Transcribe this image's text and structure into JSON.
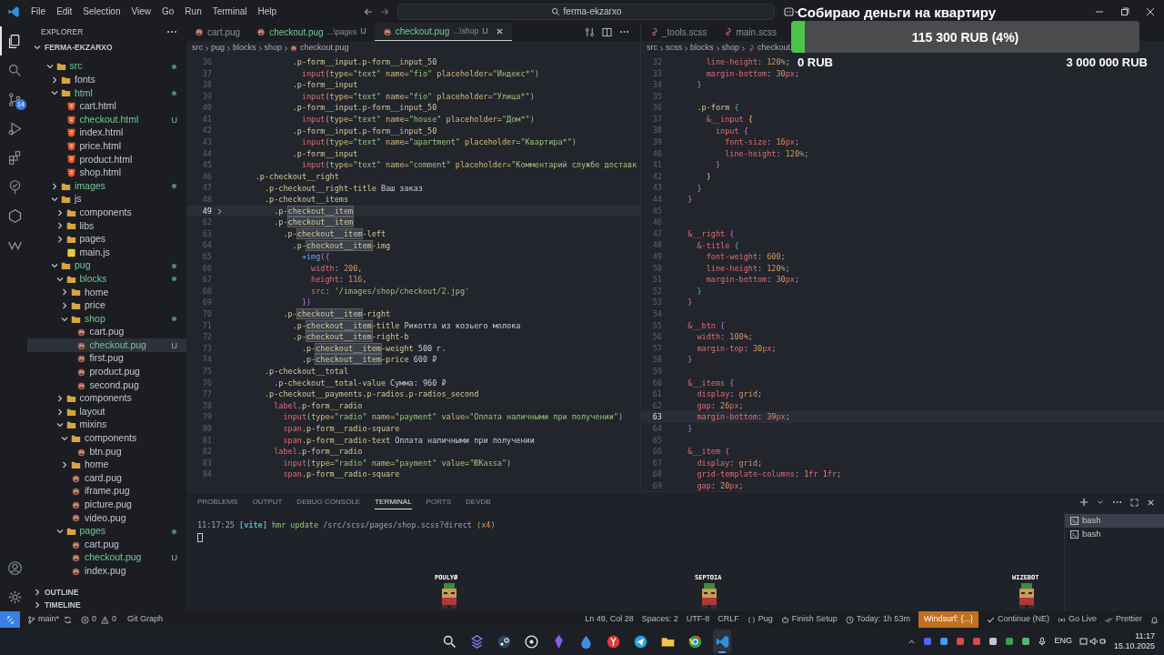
{
  "title_bar": {
    "menus": [
      "File",
      "Edit",
      "Selection",
      "View",
      "Go",
      "Run",
      "Terminal",
      "Help"
    ],
    "search": {
      "value": "ferma-ekzarxo"
    }
  },
  "activity_bar": {
    "items": [
      {
        "kind": "explorer",
        "selected": true
      },
      {
        "kind": "search",
        "selected": false
      },
      {
        "kind": "scm",
        "selected": false,
        "badge": "14"
      },
      {
        "kind": "debug",
        "selected": false
      },
      {
        "kind": "extensions",
        "selected": false
      },
      {
        "kind": "tree",
        "selected": false
      },
      {
        "kind": "hexagon",
        "selected": false
      },
      {
        "kind": "wave",
        "selected": false
      }
    ],
    "bottom": [
      {
        "kind": "account"
      },
      {
        "kind": "settings"
      }
    ]
  },
  "sidebar": {
    "title": "EXPLORER",
    "section": "FERMA-EKZARXO",
    "tree": [
      {
        "name": "src",
        "kind": "folder",
        "expanded": true,
        "changed": true,
        "selected": false,
        "children": [
          {
            "name": "fonts",
            "kind": "folder",
            "expanded": false,
            "changed": false,
            "selected": false
          },
          {
            "name": "html",
            "kind": "folder",
            "expanded": true,
            "changed": true,
            "selected": false,
            "children": [
              {
                "name": "cart.html",
                "kind": "html",
                "changed": false,
                "selected": false
              },
              {
                "name": "checkout.html",
                "kind": "html",
                "changed": true,
                "selected": false,
                "badge": "U"
              },
              {
                "name": "index.html",
                "kind": "html",
                "changed": false,
                "selected": false
              },
              {
                "name": "price.html",
                "kind": "html",
                "changed": false,
                "selected": false
              },
              {
                "name": "product.html",
                "kind": "html",
                "changed": false,
                "selected": false
              },
              {
                "name": "shop.html",
                "kind": "html",
                "changed": false,
                "selected": false
              }
            ]
          },
          {
            "name": "images",
            "kind": "folder",
            "expanded": false,
            "changed": true,
            "selected": false
          },
          {
            "name": "js",
            "kind": "folder",
            "expanded": true,
            "changed": false,
            "selected": false,
            "children": [
              {
                "name": "components",
                "kind": "folder",
                "expanded": false,
                "changed": false,
                "selected": false
              },
              {
                "name": "libs",
                "kind": "folder",
                "expanded": false,
                "changed": false,
                "selected": false
              },
              {
                "name": "pages",
                "kind": "folder",
                "expanded": false,
                "changed": false,
                "selected": false
              },
              {
                "name": "main.js",
                "kind": "js",
                "changed": false,
                "selected": false
              }
            ]
          },
          {
            "name": "pug",
            "kind": "folder",
            "expanded": true,
            "changed": true,
            "selected": false,
            "children": [
              {
                "name": "blocks",
                "kind": "folder",
                "expanded": true,
                "changed": true,
                "selected": false,
                "children": [
                  {
                    "name": "home",
                    "kind": "folder",
                    "expanded": false,
                    "changed": false,
                    "selected": false
                  },
                  {
                    "name": "price",
                    "kind": "folder",
                    "expanded": false,
                    "changed": false,
                    "selected": false
                  },
                  {
                    "name": "shop",
                    "kind": "folder",
                    "expanded": true,
                    "changed": true,
                    "selected": false,
                    "children": [
                      {
                        "name": "cart.pug",
                        "kind": "pug",
                        "changed": false,
                        "selected": false
                      },
                      {
                        "name": "checkout.pug",
                        "kind": "pug",
                        "changed": true,
                        "selected": true,
                        "badge": "U"
                      },
                      {
                        "name": "first.pug",
                        "kind": "pug",
                        "changed": false,
                        "selected": false
                      },
                      {
                        "name": "product.pug",
                        "kind": "pug",
                        "changed": false,
                        "selected": false
                      },
                      {
                        "name": "second.pug",
                        "kind": "pug",
                        "changed": false,
                        "selected": false
                      }
                    ]
                  }
                ]
              },
              {
                "name": "components",
                "kind": "folder",
                "expanded": false,
                "changed": false,
                "selected": false
              },
              {
                "name": "layout",
                "kind": "folder",
                "expanded": false,
                "changed": false,
                "selected": false
              },
              {
                "name": "mixins",
                "kind": "folder",
                "expanded": true,
                "changed": false,
                "selected": false,
                "children": [
                  {
                    "name": "components",
                    "kind": "folder",
                    "expanded": true,
                    "changed": false,
                    "selected": false,
                    "children": [
                      {
                        "name": "btn.pug",
                        "kind": "pug",
                        "changed": false,
                        "selected": false
                      }
                    ]
                  },
                  {
                    "name": "home",
                    "kind": "folder",
                    "expanded": false,
                    "changed": false,
                    "selected": false
                  },
                  {
                    "name": "card.pug",
                    "kind": "pug",
                    "changed": false,
                    "selected": false
                  },
                  {
                    "name": "iframe.pug",
                    "kind": "pug",
                    "changed": false,
                    "selected": false
                  },
                  {
                    "name": "picture.pug",
                    "kind": "pug",
                    "changed": false,
                    "selected": false
                  },
                  {
                    "name": "video.pug",
                    "kind": "pug",
                    "changed": false,
                    "selected": false
                  }
                ]
              },
              {
                "name": "pages",
                "kind": "folder",
                "expanded": true,
                "changed": true,
                "selected": false,
                "children": [
                  {
                    "name": "cart.pug",
                    "kind": "pug",
                    "changed": false,
                    "selected": false
                  },
                  {
                    "name": "checkout.pug",
                    "kind": "pug",
                    "changed": true,
                    "selected": false,
                    "badge": "U"
                  },
                  {
                    "name": "index.pug",
                    "kind": "pug",
                    "changed": false,
                    "selected": false
                  }
                ]
              }
            ]
          }
        ]
      }
    ],
    "bottom_sections": [
      "OUTLINE",
      "TIMELINE"
    ]
  },
  "left_editor": {
    "tabs": [
      {
        "label": "cart.pug",
        "selected": false
      },
      {
        "label": "checkout.pug",
        "detail": "...\\pages",
        "badge": "U",
        "selected": false
      },
      {
        "label": "checkout.pug",
        "detail": "...\\shop",
        "badge": "U",
        "selected": true
      }
    ],
    "breadcrumb": [
      "src",
      "pug",
      "blocks",
      "shop",
      "checkout.pug"
    ],
    "lines": [
      {
        "num": "36",
        "current": false,
        "folded": false,
        "tokens": [
          {
            "text": "              .p-form__input.p-form__input_50",
            "kind": "cls"
          }
        ]
      },
      {
        "num": "37",
        "current": false,
        "folded": false,
        "tokens": [
          {
            "text": "                input",
            "kind": "tag"
          },
          {
            "text": "(",
            "kind": "p"
          },
          {
            "text": "type=",
            "kind": "attr"
          },
          {
            "text": "\"text\"",
            "kind": "str"
          },
          {
            "text": " name=",
            "kind": "attr"
          },
          {
            "text": "\"fio\"",
            "kind": "str"
          },
          {
            "text": " placeholder=",
            "kind": "attr"
          },
          {
            "text": "\"Индекс*\"",
            "kind": "str"
          },
          {
            "text": ")",
            "kind": "p"
          }
        ]
      },
      {
        "num": "38",
        "current": false,
        "folded": false,
        "tokens": [
          {
            "text": "              .p-form__input",
            "kind": "cls"
          }
        ]
      },
      {
        "num": "39",
        "current": false,
        "folded": false,
        "tokens": [
          {
            "text": "                input",
            "kind": "tag"
          },
          {
            "text": "(",
            "kind": "p"
          },
          {
            "text": "type=",
            "kind": "attr"
          },
          {
            "text": "\"text\"",
            "kind": "str"
          },
          {
            "text": " name=",
            "kind": "attr"
          },
          {
            "text": "\"fio\"",
            "kind": "str"
          },
          {
            "text": " placeholder=",
            "kind": "attr"
          },
          {
            "text": "\"Улица*\"",
            "kind": "str"
          },
          {
            "text": ")",
            "kind": "p"
          }
        ]
      },
      {
        "num": "40",
        "current": false,
        "folded": false,
        "tokens": [
          {
            "text": "              .p-form__input.p-form__input_50",
            "kind": "cls"
          }
        ]
      },
      {
        "num": "41",
        "current": false,
        "folded": false,
        "tokens": [
          {
            "text": "                input",
            "kind": "tag"
          },
          {
            "text": "(",
            "kind": "p"
          },
          {
            "text": "type=",
            "kind": "attr"
          },
          {
            "text": "\"text\"",
            "kind": "str"
          },
          {
            "text": " name=",
            "kind": "attr"
          },
          {
            "text": "\"house\"",
            "kind": "str"
          },
          {
            "text": " placeholder=",
            "kind": "attr"
          },
          {
            "text": "\"Дом*\"",
            "kind": "str"
          },
          {
            "text": ")",
            "kind": "p"
          }
        ]
      },
      {
        "num": "42",
        "current": false,
        "folded": false,
        "tokens": [
          {
            "text": "              .p-form__input.p-form__input_50",
            "kind": "cls"
          }
        ]
      },
      {
        "num": "43",
        "current": false,
        "folded": false,
        "tokens": [
          {
            "text": "                input",
            "kind": "tag"
          },
          {
            "text": "(",
            "kind": "p"
          },
          {
            "text": "type=",
            "kind": "attr"
          },
          {
            "text": "\"text\"",
            "kind": "str"
          },
          {
            "text": " name=",
            "kind": "attr"
          },
          {
            "text": "\"apartment\"",
            "kind": "str"
          },
          {
            "text": " placeholder=",
            "kind": "attr"
          },
          {
            "text": "\"Квартира*\"",
            "kind": "str"
          },
          {
            "text": ")",
            "kind": "p"
          }
        ]
      },
      {
        "num": "44",
        "current": false,
        "folded": false,
        "tokens": [
          {
            "text": "              .p-form__input",
            "kind": "cls"
          }
        ]
      },
      {
        "num": "45",
        "current": false,
        "folded": false,
        "tokens": [
          {
            "text": "                input",
            "kind": "tag"
          },
          {
            "text": "(",
            "kind": "p"
          },
          {
            "text": "type=",
            "kind": "attr"
          },
          {
            "text": "\"text\"",
            "kind": "str"
          },
          {
            "text": " name=",
            "kind": "attr"
          },
          {
            "text": "\"comment\"",
            "kind": "str"
          },
          {
            "text": " placeholder=",
            "kind": "attr"
          },
          {
            "text": "\"Комментарий службе доставк",
            "kind": "str"
          }
        ]
      },
      {
        "num": "46",
        "current": false,
        "folded": false,
        "tokens": [
          {
            "text": "      .p-checkout__right",
            "kind": "cls"
          }
        ]
      },
      {
        "num": "47",
        "current": false,
        "folded": false,
        "tokens": [
          {
            "text": "        .p-checkout__right-title",
            "kind": "cls"
          },
          {
            "text": " Ваш заказ",
            "kind": "text"
          }
        ]
      },
      {
        "num": "48",
        "current": false,
        "folded": false,
        "tokens": [
          {
            "text": "        .p-checkout__items",
            "kind": "cls"
          }
        ]
      },
      {
        "num": "49",
        "current": true,
        "folded": true,
        "tokens": [
          {
            "text": "          .p-",
            "kind": "cls"
          },
          {
            "text": "checkout__item",
            "kind": "match"
          }
        ]
      },
      {
        "num": "62",
        "current": false,
        "folded": false,
        "tokens": [
          {
            "text": "          .p-",
            "kind": "cls"
          },
          {
            "text": "checkout__item",
            "kind": "match"
          }
        ]
      },
      {
        "num": "63",
        "current": false,
        "folded": false,
        "tokens": [
          {
            "text": "            .p-",
            "kind": "cls"
          },
          {
            "text": "checkout__item",
            "kind": "match"
          },
          {
            "text": "-left",
            "kind": "cls"
          }
        ]
      },
      {
        "num": "64",
        "current": false,
        "folded": false,
        "tokens": [
          {
            "text": "              .p-",
            "kind": "cls"
          },
          {
            "text": "checkout__item",
            "kind": "match"
          },
          {
            "text": "-img",
            "kind": "cls"
          }
        ]
      },
      {
        "num": "65",
        "current": false,
        "folded": false,
        "tokens": [
          {
            "text": "                +img",
            "kind": "func"
          },
          {
            "text": "({",
            "kind": "brace"
          }
        ]
      },
      {
        "num": "66",
        "current": false,
        "folded": false,
        "tokens": [
          {
            "text": "                  width",
            "kind": "prop"
          },
          {
            "text": ": ",
            "kind": "p"
          },
          {
            "text": "200",
            "kind": "num"
          },
          {
            "text": ",",
            "kind": "p"
          }
        ]
      },
      {
        "num": "67",
        "current": false,
        "folded": false,
        "tokens": [
          {
            "text": "                  height",
            "kind": "prop"
          },
          {
            "text": ": ",
            "kind": "p"
          },
          {
            "text": "116",
            "kind": "num"
          },
          {
            "text": ",",
            "kind": "p"
          }
        ]
      },
      {
        "num": "68",
        "current": false,
        "folded": false,
        "tokens": [
          {
            "text": "                  src",
            "kind": "prop"
          },
          {
            "text": ": ",
            "kind": "p"
          },
          {
            "text": "'/images/shop/checkout/2.jpg'",
            "kind": "str"
          }
        ]
      },
      {
        "num": "69",
        "current": false,
        "folded": false,
        "tokens": [
          {
            "text": "                })",
            "kind": "brace"
          }
        ]
      },
      {
        "num": "70",
        "current": false,
        "folded": false,
        "tokens": [
          {
            "text": "            .p-",
            "kind": "cls"
          },
          {
            "text": "checkout__item",
            "kind": "match"
          },
          {
            "text": "-right",
            "kind": "cls"
          }
        ]
      },
      {
        "num": "71",
        "current": false,
        "folded": false,
        "tokens": [
          {
            "text": "              .p-",
            "kind": "cls"
          },
          {
            "text": "checkout__item",
            "kind": "match"
          },
          {
            "text": "-title",
            "kind": "cls"
          },
          {
            "text": " Рикотта из козьего молока",
            "kind": "text"
          }
        ]
      },
      {
        "num": "72",
        "current": false,
        "folded": false,
        "tokens": [
          {
            "text": "              .p-",
            "kind": "cls"
          },
          {
            "text": "checkout__item",
            "kind": "match"
          },
          {
            "text": "-right-b",
            "kind": "cls"
          }
        ]
      },
      {
        "num": "73",
        "current": false,
        "folded": false,
        "tokens": [
          {
            "text": "                .p-",
            "kind": "cls"
          },
          {
            "text": "checkout__item",
            "kind": "match"
          },
          {
            "text": "-weight",
            "kind": "cls"
          },
          {
            "text": " 500 г.",
            "kind": "text"
          }
        ]
      },
      {
        "num": "74",
        "current": false,
        "folded": false,
        "tokens": [
          {
            "text": "                .p-",
            "kind": "cls"
          },
          {
            "text": "checkout__item",
            "kind": "match"
          },
          {
            "text": "-price",
            "kind": "cls"
          },
          {
            "text": " 600 ₽",
            "kind": "text"
          }
        ]
      },
      {
        "num": "75",
        "current": false,
        "folded": false,
        "tokens": [
          {
            "text": "        .p-checkout__total",
            "kind": "cls"
          }
        ]
      },
      {
        "num": "76",
        "current": false,
        "folded": false,
        "tokens": [
          {
            "text": "          .p-checkout__total-value",
            "kind": "cls"
          },
          {
            "text": " Сумма: 960 ₽",
            "kind": "text"
          }
        ]
      },
      {
        "num": "77",
        "current": false,
        "folded": false,
        "tokens": [
          {
            "text": "        .p-checkout__payments.p-radios.p-radios_second",
            "kind": "cls"
          }
        ]
      },
      {
        "num": "78",
        "current": false,
        "folded": false,
        "tokens": [
          {
            "text": "          label",
            "kind": "tag"
          },
          {
            "text": ".p-form__radio",
            "kind": "cls"
          }
        ]
      },
      {
        "num": "79",
        "current": false,
        "folded": false,
        "tokens": [
          {
            "text": "            input",
            "kind": "tag"
          },
          {
            "text": "(",
            "kind": "p"
          },
          {
            "text": "type=",
            "kind": "attr"
          },
          {
            "text": "\"radio\"",
            "kind": "str"
          },
          {
            "text": " name=",
            "kind": "attr"
          },
          {
            "text": "\"payment\"",
            "kind": "str"
          },
          {
            "text": " value=",
            "kind": "attr"
          },
          {
            "text": "\"Оплата наличными при получении\"",
            "kind": "str"
          },
          {
            "text": ")",
            "kind": "p"
          }
        ]
      },
      {
        "num": "80",
        "current": false,
        "folded": false,
        "tokens": [
          {
            "text": "            span",
            "kind": "tag"
          },
          {
            "text": ".p-form__radio-square",
            "kind": "cls"
          }
        ]
      },
      {
        "num": "81",
        "current": false,
        "folded": false,
        "tokens": [
          {
            "text": "            span",
            "kind": "tag"
          },
          {
            "text": ".p-form__radio-text",
            "kind": "cls"
          },
          {
            "text": " Оплата наличными при получении",
            "kind": "text"
          }
        ]
      },
      {
        "num": "82",
        "current": false,
        "folded": false,
        "tokens": [
          {
            "text": "          label",
            "kind": "tag"
          },
          {
            "text": ".p-form__radio",
            "kind": "cls"
          }
        ]
      },
      {
        "num": "83",
        "current": false,
        "folded": false,
        "tokens": [
          {
            "text": "            input",
            "kind": "tag"
          },
          {
            "text": "(",
            "kind": "p"
          },
          {
            "text": "type=",
            "kind": "attr"
          },
          {
            "text": "\"radio\"",
            "kind": "str"
          },
          {
            "text": " name=",
            "kind": "attr"
          },
          {
            "text": "\"payment\"",
            "kind": "str"
          },
          {
            "text": " value=",
            "kind": "attr"
          },
          {
            "text": "\"ЮKassa\"",
            "kind": "str"
          },
          {
            "text": ")",
            "kind": "p"
          }
        ]
      },
      {
        "num": "84",
        "current": false,
        "folded": false,
        "tokens": [
          {
            "text": "            span",
            "kind": "tag"
          },
          {
            "text": ".p-form__radio-square",
            "kind": "cls"
          }
        ]
      }
    ]
  },
  "right_editor": {
    "tabs": [
      {
        "label": "_tools.scss",
        "selected": false
      },
      {
        "label": "main.scss",
        "selected": false
      }
    ],
    "breadcrumb": [
      "src",
      "scss",
      "blocks",
      "shop",
      "checkout."
    ],
    "lines": [
      {
        "num": "32",
        "current": false,
        "tokens": [
          {
            "text": "      line-height",
            "kind": "prop"
          },
          {
            "text": ": ",
            "kind": "p"
          },
          {
            "text": "120%",
            "kind": "num"
          },
          {
            "text": ";",
            "kind": "p"
          }
        ]
      },
      {
        "num": "33",
        "current": false,
        "tokens": [
          {
            "text": "      margin-bottom",
            "kind": "prop"
          },
          {
            "text": ": ",
            "kind": "p"
          },
          {
            "text": "30",
            "kind": "num"
          },
          {
            "text": "px",
            "kind": "unit"
          },
          {
            "text": ";",
            "kind": "p"
          }
        ]
      },
      {
        "num": "34",
        "current": false,
        "tokens": [
          {
            "text": "    }",
            "kind": "b2"
          }
        ]
      },
      {
        "num": "35",
        "current": false
      },
      {
        "num": "36",
        "current": false,
        "tokens": [
          {
            "text": "    .p-form",
            "kind": "cls"
          },
          {
            "text": " {",
            "kind": "b2"
          }
        ]
      },
      {
        "num": "37",
        "current": false,
        "tokens": [
          {
            "text": "      &__input",
            "kind": "sel"
          },
          {
            "text": " {",
            "kind": "b3"
          }
        ]
      },
      {
        "num": "38",
        "current": false,
        "tokens": [
          {
            "text": "        input",
            "kind": "tag"
          },
          {
            "text": " {",
            "kind": "b1"
          }
        ]
      },
      {
        "num": "39",
        "current": false,
        "tokens": [
          {
            "text": "          font-size",
            "kind": "prop"
          },
          {
            "text": ": ",
            "kind": "p"
          },
          {
            "text": "16",
            "kind": "num"
          },
          {
            "text": "px",
            "kind": "unit"
          },
          {
            "text": ";",
            "kind": "p"
          }
        ]
      },
      {
        "num": "40",
        "current": false,
        "tokens": [
          {
            "text": "          line-height",
            "kind": "prop"
          },
          {
            "text": ": ",
            "kind": "p"
          },
          {
            "text": "120%",
            "kind": "num"
          },
          {
            "text": ";",
            "kind": "p"
          }
        ]
      },
      {
        "num": "41",
        "current": false,
        "tokens": [
          {
            "text": "        }",
            "kind": "b1"
          }
        ]
      },
      {
        "num": "42",
        "current": false,
        "tokens": [
          {
            "text": "      }",
            "kind": "b3"
          }
        ]
      },
      {
        "num": "43",
        "current": false,
        "tokens": [
          {
            "text": "    }",
            "kind": "b2"
          }
        ]
      },
      {
        "num": "44",
        "current": false,
        "tokens": [
          {
            "text": "  }",
            "kind": "b1"
          }
        ]
      },
      {
        "num": "45",
        "current": false
      },
      {
        "num": "46",
        "current": false
      },
      {
        "num": "47",
        "current": false,
        "tokens": [
          {
            "text": "  &__right",
            "kind": "sel"
          },
          {
            "text": " {",
            "kind": "b1"
          }
        ]
      },
      {
        "num": "48",
        "current": false,
        "tokens": [
          {
            "text": "    &-title",
            "kind": "sel"
          },
          {
            "text": " {",
            "kind": "b2"
          }
        ]
      },
      {
        "num": "49",
        "current": false,
        "tokens": [
          {
            "text": "      font-weight",
            "kind": "prop"
          },
          {
            "text": ": ",
            "kind": "p"
          },
          {
            "text": "600",
            "kind": "num"
          },
          {
            "text": ";",
            "kind": "p"
          }
        ]
      },
      {
        "num": "50",
        "current": false,
        "tokens": [
          {
            "text": "      line-height",
            "kind": "prop"
          },
          {
            "text": ": ",
            "kind": "p"
          },
          {
            "text": "120%",
            "kind": "num"
          },
          {
            "text": ";",
            "kind": "p"
          }
        ]
      },
      {
        "num": "51",
        "current": false,
        "tokens": [
          {
            "text": "      margin-bottom",
            "kind": "prop"
          },
          {
            "text": ": ",
            "kind": "p"
          },
          {
            "text": "30",
            "kind": "num"
          },
          {
            "text": "px",
            "kind": "unit"
          },
          {
            "text": ";",
            "kind": "p"
          }
        ]
      },
      {
        "num": "52",
        "current": false,
        "tokens": [
          {
            "text": "    }",
            "kind": "b2"
          }
        ]
      },
      {
        "num": "53",
        "current": false,
        "tokens": [
          {
            "text": "  }",
            "kind": "b1"
          }
        ]
      },
      {
        "num": "54",
        "current": false
      },
      {
        "num": "55",
        "current": false,
        "tokens": [
          {
            "text": "  &__btn",
            "kind": "sel"
          },
          {
            "text": " {",
            "kind": "b1"
          }
        ]
      },
      {
        "num": "56",
        "current": false,
        "tokens": [
          {
            "text": "    width",
            "kind": "prop"
          },
          {
            "text": ": ",
            "kind": "p"
          },
          {
            "text": "100%",
            "kind": "num"
          },
          {
            "text": ";",
            "kind": "p"
          }
        ]
      },
      {
        "num": "57",
        "current": false,
        "tokens": [
          {
            "text": "    margin-top",
            "kind": "prop"
          },
          {
            "text": ": ",
            "kind": "p"
          },
          {
            "text": "30",
            "kind": "num"
          },
          {
            "text": "px",
            "kind": "unit"
          },
          {
            "text": ";",
            "kind": "p"
          }
        ]
      },
      {
        "num": "58",
        "current": false,
        "tokens": [
          {
            "text": "  }",
            "kind": "b1"
          }
        ]
      },
      {
        "num": "59",
        "current": false
      },
      {
        "num": "60",
        "current": false,
        "tokens": [
          {
            "text": "  &__items",
            "kind": "sel"
          },
          {
            "text": " {",
            "kind": "b1"
          }
        ]
      },
      {
        "num": "61",
        "current": false,
        "tokens": [
          {
            "text": "    display",
            "kind": "prop"
          },
          {
            "text": ": ",
            "kind": "p"
          },
          {
            "text": "grid",
            "kind": "num"
          },
          {
            "text": ";",
            "kind": "p"
          }
        ]
      },
      {
        "num": "62",
        "current": false,
        "tokens": [
          {
            "text": "    gap",
            "kind": "prop"
          },
          {
            "text": ": ",
            "kind": "p"
          },
          {
            "text": "26",
            "kind": "num"
          },
          {
            "text": "px",
            "kind": "unit"
          },
          {
            "text": ";",
            "kind": "p"
          }
        ]
      },
      {
        "num": "63",
        "current": true,
        "tokens": [
          {
            "text": "    margin-bottom",
            "kind": "prop"
          },
          {
            "text": ": ",
            "kind": "p"
          },
          {
            "text": "39",
            "kind": "num"
          },
          {
            "text": "px",
            "kind": "unit"
          },
          {
            "text": ";",
            "kind": "p"
          }
        ]
      },
      {
        "num": "64",
        "current": false,
        "tokens": [
          {
            "text": "  }",
            "kind": "b1"
          }
        ]
      },
      {
        "num": "65",
        "current": false
      },
      {
        "num": "66",
        "current": false,
        "tokens": [
          {
            "text": "  &__item",
            "kind": "sel"
          },
          {
            "text": " {",
            "kind": "b1"
          }
        ]
      },
      {
        "num": "67",
        "current": false,
        "tokens": [
          {
            "text": "    display",
            "kind": "prop"
          },
          {
            "text": ": ",
            "kind": "p"
          },
          {
            "text": "grid",
            "kind": "num"
          },
          {
            "text": ";",
            "kind": "p"
          }
        ]
      },
      {
        "num": "68",
        "current": false,
        "tokens": [
          {
            "text": "    grid-template-columns",
            "kind": "prop"
          },
          {
            "text": ": ",
            "kind": "p"
          },
          {
            "text": "1",
            "kind": "num"
          },
          {
            "text": "fr",
            "kind": "unit"
          },
          {
            "text": " 1",
            "kind": "num"
          },
          {
            "text": "fr",
            "kind": "unit"
          },
          {
            "text": ";",
            "kind": "p"
          }
        ]
      },
      {
        "num": "69",
        "current": false,
        "tokens": [
          {
            "text": "    gap",
            "kind": "prop"
          },
          {
            "text": ": ",
            "kind": "p"
          },
          {
            "text": "20",
            "kind": "num"
          },
          {
            "text": "px",
            "kind": "unit"
          },
          {
            "text": ";",
            "kind": "p"
          }
        ]
      }
    ]
  },
  "panel": {
    "tabs": [
      {
        "label": "PROBLEMS",
        "selected": false
      },
      {
        "label": "OUTPUT",
        "selected": false
      },
      {
        "label": "DEBUG CONSOLE",
        "selected": false
      },
      {
        "label": "TERMINAL",
        "selected": true
      },
      {
        "label": "PORTS",
        "selected": false
      },
      {
        "label": "DEVDB",
        "selected": false
      }
    ],
    "terminal_line": [
      {
        "text": "11:17:25 ",
        "kind": "time"
      },
      {
        "text": "[vite]",
        "kind": "tool"
      },
      {
        "text": " hmr update ",
        "kind": "msg"
      },
      {
        "text": "/src/scss/pages/shop.scss?direct",
        "kind": "path"
      },
      {
        "text": " (x4)",
        "kind": "count"
      }
    ],
    "terminals": [
      {
        "label": "bash",
        "selected": true
      },
      {
        "label": "bash",
        "selected": false
      }
    ]
  },
  "status_bar": {
    "branch": "main*",
    "errors": "0",
    "warnings": "0",
    "git_graph": "Git Graph",
    "items": [
      {
        "text": "Ln 49, Col 28",
        "kind": "plain"
      },
      {
        "text": "Spaces: 2",
        "kind": "plain"
      },
      {
        "text": "UTF-8",
        "kind": "plain"
      },
      {
        "text": "CRLF",
        "kind": "plain"
      },
      {
        "text": "Pug",
        "kind": "language"
      },
      {
        "text": "Finish Setup",
        "kind": "setup"
      },
      {
        "text": "Today: 1h 53m",
        "kind": "time"
      },
      {
        "text": "Windsurf: {...}",
        "kind": "highlight"
      },
      {
        "text": "Continue (NE)",
        "kind": "check"
      },
      {
        "text": "Go Live",
        "kind": "live"
      },
      {
        "text": "Prettier",
        "kind": "double-check"
      }
    ]
  },
  "donation_widget": {
    "title": "Собираю деньги на квартиру",
    "level": 0.04,
    "raised": "115 300 RUB (4%)",
    "min": "0 RUB",
    "goal": "3 000 000 RUB"
  },
  "stream_overlay": {
    "names": [
      "POULYØ",
      "SEPTOIA",
      "WIZEBOT"
    ]
  },
  "taskbar": {
    "apps": [
      {
        "kind": "search",
        "selected": false
      },
      {
        "kind": "stack",
        "selected": false
      },
      {
        "kind": "steam",
        "selected": false
      },
      {
        "kind": "circle",
        "selected": false
      },
      {
        "kind": "crystal",
        "selected": false
      },
      {
        "kind": "drop",
        "selected": false
      },
      {
        "kind": "browser",
        "selected": false
      },
      {
        "kind": "telegram",
        "selected": false
      },
      {
        "kind": "folder",
        "selected": false
      },
      {
        "kind": "chrome",
        "selected": false
      },
      {
        "kind": "vscode",
        "selected": true
      }
    ],
    "language": "ENG",
    "time": "11:17",
    "date": "15.10.2025"
  }
}
